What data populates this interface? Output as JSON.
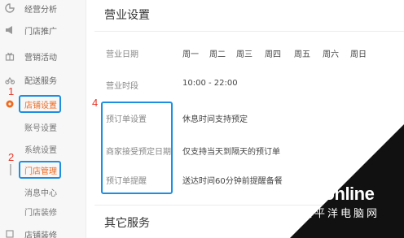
{
  "sidebar": {
    "items": [
      {
        "icon": "chart-icon",
        "label": "经营分析"
      },
      {
        "icon": "megaphone-icon",
        "label": "门店推广"
      },
      {
        "icon": "gift-icon",
        "label": "营销活动"
      },
      {
        "icon": "delivery-icon",
        "label": "配送服务"
      },
      {
        "icon": "gear-icon",
        "label": "店铺设置"
      }
    ],
    "sub_items": [
      "账号设置",
      "系统设置",
      "门店管理",
      "消息中心",
      "门店装修"
    ],
    "bottom_item": "店铺装修"
  },
  "annotations": {
    "num1": "1",
    "num2": "2",
    "num4": "4"
  },
  "main": {
    "title": "营业设置",
    "business_days_label": "营业日期",
    "days": [
      "周一",
      "周二",
      "周三",
      "周四",
      "周五",
      "周六",
      "周日"
    ],
    "business_hours_label": "营业时段",
    "business_hours_value": "10:00 - 22:00",
    "preorder_settings_label": "预订单设置",
    "preorder_settings_value": "休息时间支持预定",
    "merchant_accept_label": "商家接受预定日期",
    "merchant_accept_value": "仅支持当天到隔天的预订单",
    "preorder_reminder_label": "预订单提醒",
    "preorder_reminder_value": "送达时间60分钟前提醒备餐",
    "other_services_title": "其它服务"
  },
  "watermark": {
    "logo": "PConline",
    "subtitle": "太平洋电脑网"
  },
  "colors": {
    "highlight_box": "#1e8fe0",
    "annotation_number": "#e23a2c",
    "active_text": "#ef6a1f"
  }
}
